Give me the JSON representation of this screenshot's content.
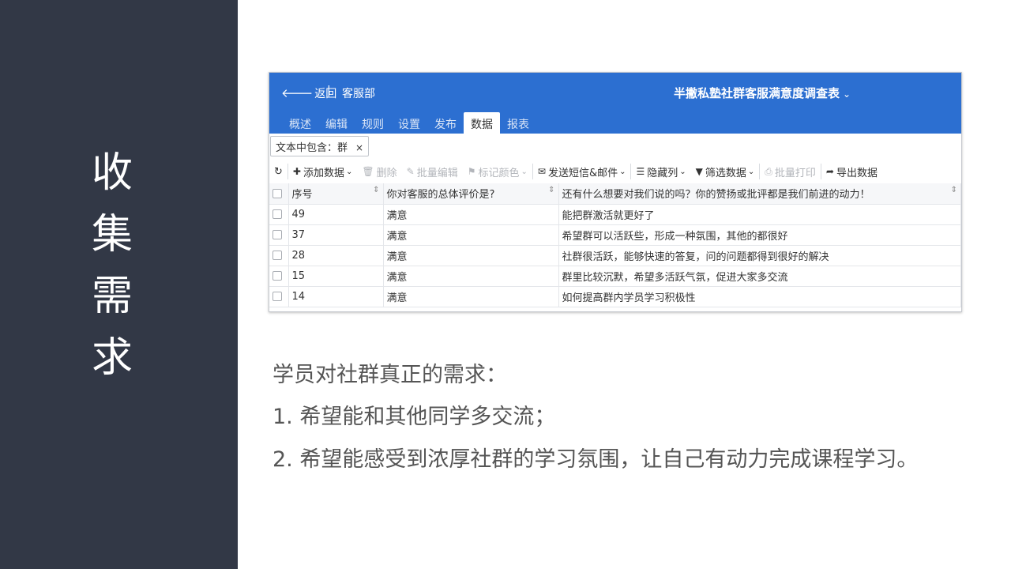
{
  "side": {
    "title_chars": [
      "收",
      "集",
      "需",
      "求"
    ]
  },
  "app": {
    "back_label": "返回",
    "separator": "|",
    "department": "客服部",
    "form_title": "半撇私塾社群客服满意度调查表",
    "title_chevron": "⌄",
    "tabs": [
      {
        "label": "概述",
        "active": false
      },
      {
        "label": "编辑",
        "active": false
      },
      {
        "label": "规则",
        "active": false
      },
      {
        "label": "设置",
        "active": false
      },
      {
        "label": "发布",
        "active": false
      },
      {
        "label": "数据",
        "active": true
      },
      {
        "label": "报表",
        "active": false
      }
    ],
    "filter_chip": "文本中包含：群",
    "filter_close": "×",
    "toolbar": {
      "refresh": "↻",
      "add_data": "添加数据",
      "delete": "删除",
      "batch_edit": "批量编辑",
      "mark_color": "标记颜色",
      "send_sms_email": "发送短信&邮件",
      "hide_columns": "隐藏列",
      "filter_data": "筛选数据",
      "batch_print": "批量打印",
      "export_data": "导出数据"
    },
    "table": {
      "headers": [
        "序号",
        "你对客服的总体评价是?",
        "还有什么想要对我们说的吗？你的赞扬或批评都是我们前进的动力！"
      ],
      "rows": [
        [
          "49",
          "满意",
          "能把群激活就更好了"
        ],
        [
          "37",
          "满意",
          "希望群可以活跃些，形成一种氛围，其他的都很好"
        ],
        [
          "28",
          "满意",
          "社群很活跃，能够快速的答复，问的问题都得到很好的解决"
        ],
        [
          "15",
          "满意",
          "群里比较沉默，希望多活跃气氛，促进大家多交流"
        ],
        [
          "14",
          "满意",
          "如何提高群内学员学习积极性"
        ]
      ]
    },
    "colors": {
      "header_bg": "#2c6fd1",
      "side_bg": "#323846"
    }
  },
  "content": {
    "line1": "学员对社群真正的需求：",
    "line2": "1. 希望能和其他同学多交流；",
    "line3": "2. 希望能感受到浓厚社群的学习氛围，让自己有动力完成课程学习。"
  }
}
